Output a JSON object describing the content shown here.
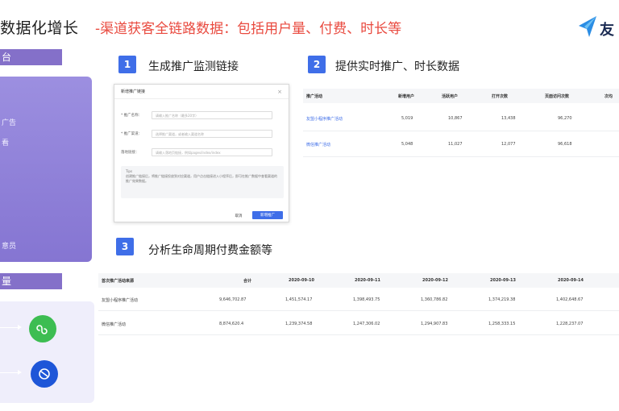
{
  "header": {
    "title": "数据化增长",
    "subtitle": "-渠道获客全链路数据：包括用户量、付费、时长等",
    "logo_text": "友"
  },
  "left": {
    "label_top": "台",
    "label_bottom": "量",
    "panel_items": [
      "广告",
      "看",
      "意员"
    ]
  },
  "steps": [
    {
      "num": "1",
      "title": "生成推广监测链接"
    },
    {
      "num": "2",
      "title": "提供实时推广、时长数据"
    },
    {
      "num": "3",
      "title": "分析生命周期付费金额等"
    }
  ],
  "dialog": {
    "title": "新增推广链接",
    "close": "×",
    "fields": [
      {
        "label": "* 推广名称：",
        "placeholder": "请输入推广名称（最多20字）"
      },
      {
        "label": "* 推广渠道：",
        "placeholder": "选择推广渠道，或者输入渠道名称"
      },
      {
        "label": "落地链接：",
        "placeholder": "请输入落地页链接，例如pages/index/index"
      }
    ],
    "tip_title": "Tips",
    "tip_text": "创建推广链接后，将推广链接投放到对应渠道，用户点击链接进入小程序后，即可在推广数据中查看渠道的推广效果数据。",
    "cancel": "取消",
    "ok": "新增推广"
  },
  "table1": {
    "headers": [
      "推广活动",
      "新增用户",
      "活跃用户",
      "打开次数",
      "页面访问次数",
      "次均"
    ],
    "rows": [
      [
        "友盟小程序推广活动",
        "5,019",
        "10,867",
        "13,438",
        "96,270"
      ],
      [
        "微信推广活动",
        "5,048",
        "11,027",
        "12,077",
        "96,618"
      ]
    ]
  },
  "table2": {
    "headers": [
      "首次推广活动来源",
      "合计",
      "2020-09-10",
      "2020-09-11",
      "2020-09-12",
      "2020-09-13",
      "2020-09-14"
    ],
    "rows": [
      [
        "友盟小程序推广活动",
        "9,646,702.87",
        "1,451,574.17",
        "1,398,493.75",
        "1,360,786.82",
        "1,374,219.38",
        "1,402,648.67"
      ],
      [
        "微信推广活动",
        "8,874,620.4",
        "1,239,374.58",
        "1,247,306.02",
        "1,294,907.83",
        "1,258,333.15",
        "1,228,237.07"
      ]
    ]
  },
  "colors": {
    "accent": "#3f6ee8",
    "subtitle_red": "#e94a3f",
    "purple": "#8470c9"
  }
}
